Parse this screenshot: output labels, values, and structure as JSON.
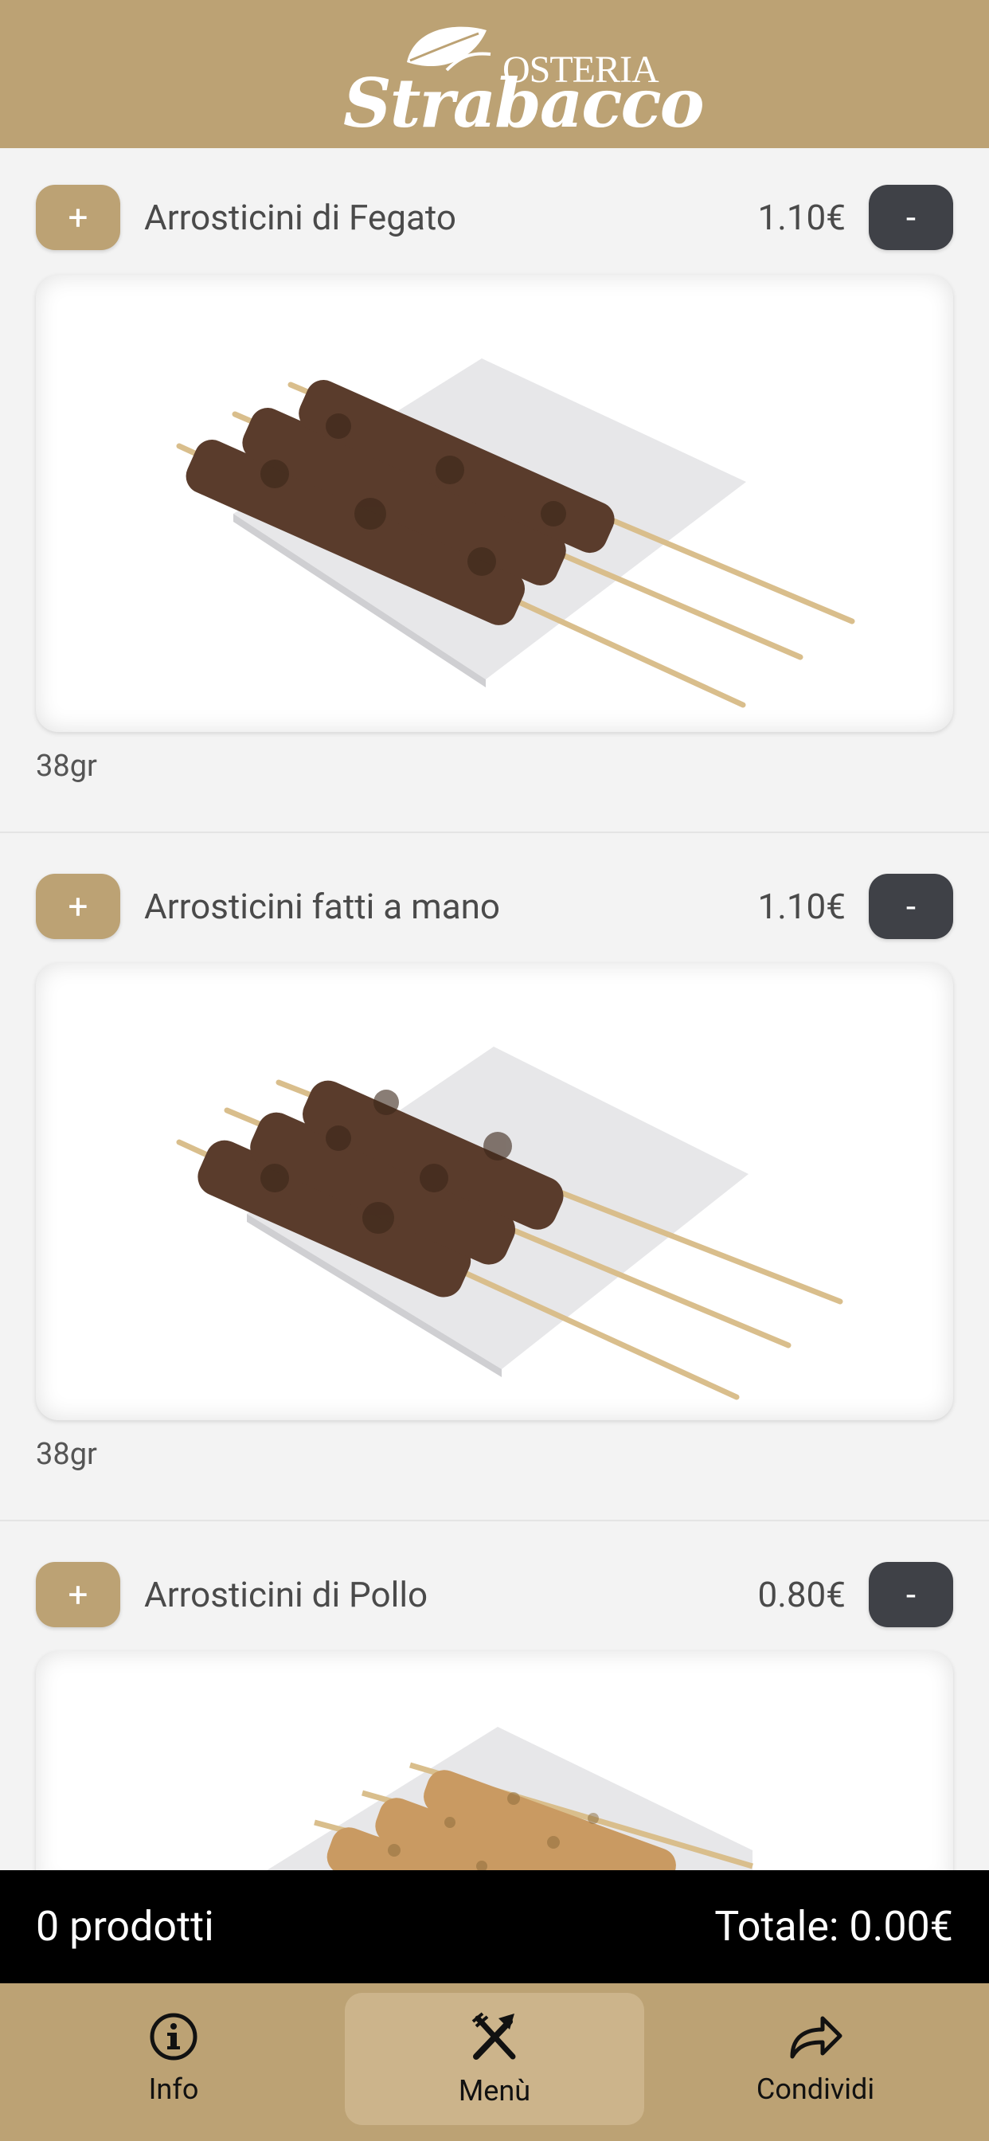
{
  "header": {
    "logo_top": "OSTERIA",
    "logo_script": "Strabacco"
  },
  "products": [
    {
      "name": "Arrosticini di Fegato",
      "price": "1.10€",
      "weight": "38gr",
      "plus": "+",
      "minus": "-"
    },
    {
      "name": "Arrosticini fatti a mano",
      "price": "1.10€",
      "weight": "38gr",
      "plus": "+",
      "minus": "-"
    },
    {
      "name": "Arrosticini di Pollo",
      "price": "0.80€",
      "plus": "+",
      "minus": "-"
    }
  ],
  "cart": {
    "count": "0 prodotti",
    "total": "Totale: 0.00€"
  },
  "tabs": [
    {
      "label": "Info",
      "icon": "info-icon"
    },
    {
      "label": "Menù",
      "icon": "cutlery-icon"
    },
    {
      "label": "Condividi",
      "icon": "share-icon"
    }
  ],
  "colors": {
    "brand": "#bca274",
    "minus_button": "#3f4147",
    "cart_bar": "#000000"
  }
}
